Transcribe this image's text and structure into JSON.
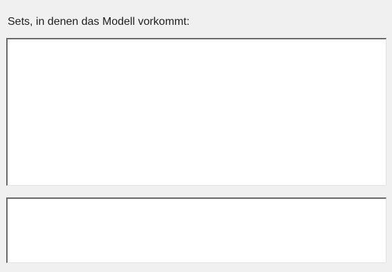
{
  "sets_panel": {
    "label": "Sets, in denen das Modell vorkommt:",
    "sets_list": {
      "items": []
    },
    "detail_list": {
      "items": []
    }
  }
}
